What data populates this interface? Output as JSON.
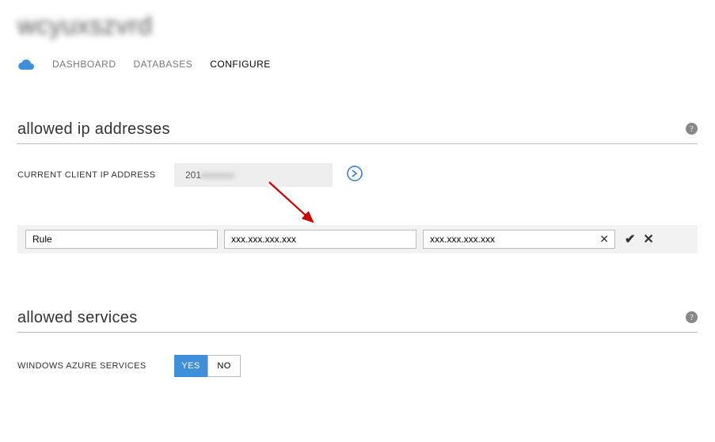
{
  "page_title": "wcyuxszvrd",
  "tabs": {
    "dashboard": "DASHBOARD",
    "databases": "DATABASES",
    "configure": "CONFIGURE"
  },
  "active_tab_index": 2,
  "allowed_ip": {
    "title": "allowed ip addresses",
    "current_label": "CURRENT CLIENT IP ADDRESS",
    "current_prefix": "201",
    "current_blurred": "xxxxxxx",
    "rule_value": "Rule",
    "start_placeholder": "xxx.xxx.xxx.xxx",
    "end_value": "xxx.xxx.xxx.xxx"
  },
  "allowed_services": {
    "title": "allowed services",
    "azure_label": "WINDOWS AZURE SERVICES",
    "yes": "YES",
    "no": "NO",
    "selected": "yes"
  },
  "icons": {
    "help": "?",
    "check": "✔",
    "cancel": "✕"
  }
}
